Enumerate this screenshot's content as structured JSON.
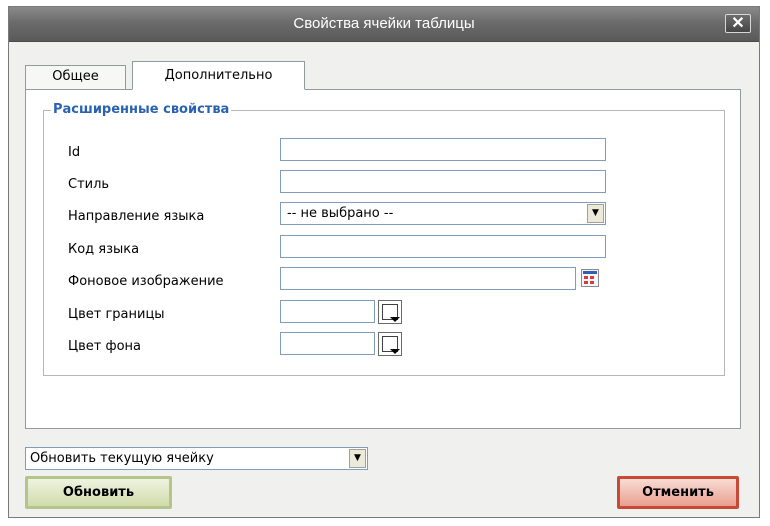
{
  "dialog": {
    "title": "Свойства ячейки таблицы",
    "close_label": "✕"
  },
  "tabs": [
    {
      "label": "Общее",
      "active": false
    },
    {
      "label": "Дополнительно",
      "active": true
    }
  ],
  "advanced": {
    "legend": "Расширенные свойства",
    "fields": {
      "id": {
        "label": "Id",
        "value": ""
      },
      "style": {
        "label": "Стиль",
        "value": ""
      },
      "dir": {
        "label": "Направление языка",
        "selected": "-- не выбрано --"
      },
      "lang": {
        "label": "Код языка",
        "value": ""
      },
      "bgimage": {
        "label": "Фоновое изображение",
        "value": ""
      },
      "bordercolor": {
        "label": "Цвет границы",
        "value": ""
      },
      "bgcolor": {
        "label": "Цвет фона",
        "value": ""
      }
    }
  },
  "footer": {
    "action_selected": "Обновить текущую ячейку",
    "update_label": "Обновить",
    "cancel_label": "Отменить"
  },
  "colors": {
    "legend": "#2a62b2",
    "title_bar": "#6b6b6b",
    "update_border": "#b5c48a",
    "cancel_border": "#c84a35"
  },
  "icons": {
    "close": "close-icon",
    "select_arrow": "chevron-down-icon",
    "browse": "browse-image-icon",
    "color_picker": "color-picker-icon"
  }
}
